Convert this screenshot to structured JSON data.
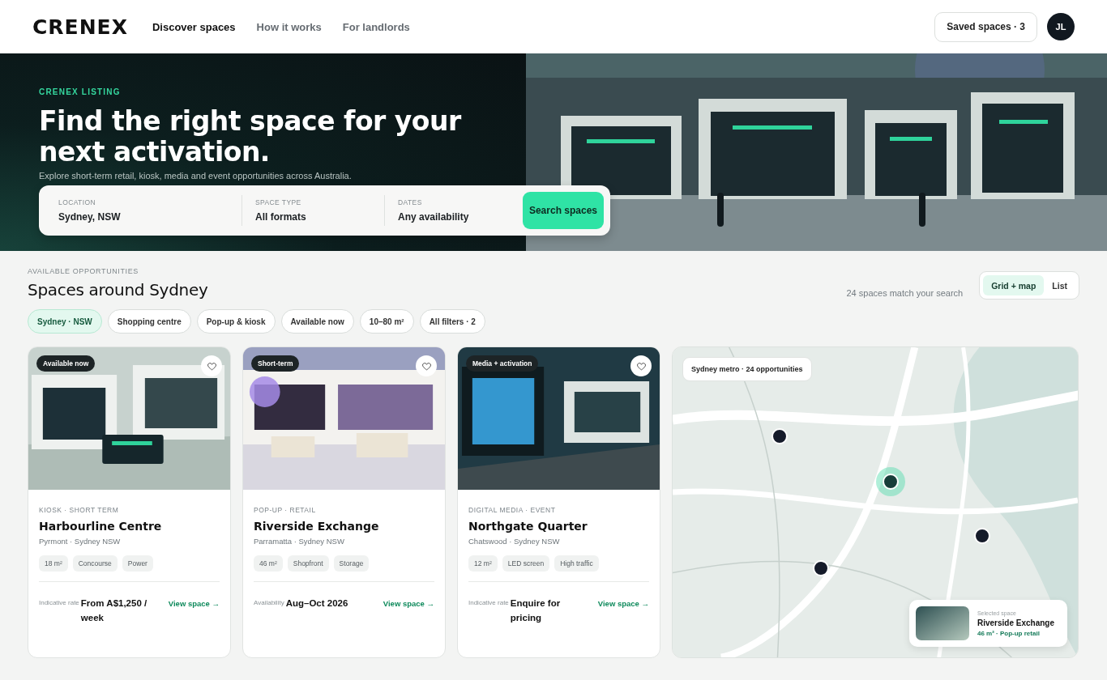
{
  "brand": {
    "logo": "CRENEX"
  },
  "nav": [
    {
      "label": "Discover spaces",
      "selected": true
    },
    {
      "label": "How it works",
      "selected": false
    },
    {
      "label": "For landlords",
      "selected": false
    }
  ],
  "saved_button": "Saved spaces · 3",
  "avatar": "JL",
  "hero": {
    "eyebrow": "CRENEX LISTING",
    "title": "Find the right space for your next activation.",
    "subtitle": "Explore short-term retail, kiosk, media and event opportunities across Australia.",
    "search": {
      "fields": [
        {
          "label": "LOCATION",
          "value": "Sydney, NSW"
        },
        {
          "label": "SPACE TYPE",
          "value": "All formats"
        },
        {
          "label": "DATES",
          "value": "Any availability"
        }
      ],
      "button": "Search spaces"
    }
  },
  "results": {
    "eyebrow": "AVAILABLE OPPORTUNITIES",
    "title": "Spaces around Sydney",
    "count": "24 spaces match your search",
    "view_toggle": [
      {
        "label": "Grid + map",
        "selected": true
      },
      {
        "label": "List",
        "selected": false
      }
    ],
    "filters": [
      {
        "label": "Sydney · NSW",
        "selected": true
      },
      {
        "label": "Shopping centre",
        "selected": false
      },
      {
        "label": "Pop-up & kiosk",
        "selected": false
      },
      {
        "label": "Available now",
        "selected": false
      },
      {
        "label": "10–80 m²",
        "selected": false
      },
      {
        "label": "All filters · 2",
        "selected": false
      }
    ]
  },
  "cards": [
    {
      "badge": "Available now",
      "saved": false,
      "category": "KIOSK · SHORT TERM",
      "name": "Harbourline Centre",
      "location": "Pyrmont · Sydney NSW",
      "tags": [
        "18 m²",
        "Concourse",
        "Power"
      ],
      "price_label": "Indicative rate",
      "price": "From A$1,250 / week",
      "link": "View space →"
    },
    {
      "badge": "Short-term",
      "saved": false,
      "category": "POP-UP · RETAIL",
      "name": "Riverside Exchange",
      "location": "Parramatta · Sydney NSW",
      "tags": [
        "46 m²",
        "Shopfront",
        "Storage"
      ],
      "price_label": "Availability",
      "price": "Aug–Oct 2026",
      "link": "View space →"
    },
    {
      "badge": "Media + activation",
      "saved": false,
      "category": "DIGITAL MEDIA · EVENT",
      "name": "Northgate Quarter",
      "location": "Chatswood · Sydney NSW",
      "tags": [
        "12 m²",
        "LED screen",
        "High traffic"
      ],
      "price_label": "Indicative rate",
      "price": "Enquire for pricing",
      "link": "View space →"
    }
  ],
  "map": {
    "badge": "Sydney metro · 24 opportunities",
    "pins": [
      {
        "selected": false
      },
      {
        "selected": true
      },
      {
        "selected": false
      },
      {
        "selected": false
      }
    ],
    "selected_space": {
      "caption": "Selected space",
      "name": "Riverside Exchange",
      "details": "46 m² · Pop-up retail"
    }
  }
}
